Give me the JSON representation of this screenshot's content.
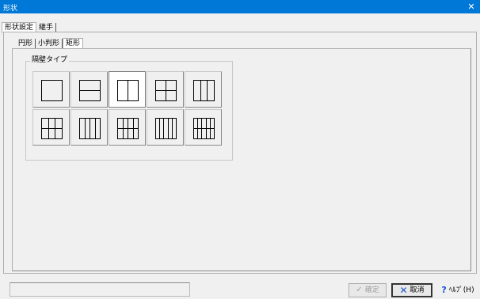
{
  "window": {
    "title": "形状"
  },
  "outer_tabs": [
    {
      "label": "形状設定",
      "active": true
    },
    {
      "label": "継手",
      "active": false
    }
  ],
  "inner_tabs": [
    {
      "label": "円形",
      "active": false
    },
    {
      "label": "小判形",
      "active": false
    },
    {
      "label": "矩形",
      "active": true
    }
  ],
  "partition": {
    "group_label": "隔壁タイプ",
    "selected": "1x2",
    "options": [
      {
        "name": "1x1",
        "rows": 1,
        "cols": 1
      },
      {
        "name": "2x1",
        "rows": 2,
        "cols": 1
      },
      {
        "name": "1x2",
        "rows": 1,
        "cols": 2
      },
      {
        "name": "2x2",
        "rows": 2,
        "cols": 2
      },
      {
        "name": "1x3",
        "rows": 1,
        "cols": 3
      },
      {
        "name": "2x3",
        "rows": 2,
        "cols": 3
      },
      {
        "name": "1x4",
        "rows": 1,
        "cols": 4
      },
      {
        "name": "2x4",
        "rows": 2,
        "cols": 4
      },
      {
        "name": "1x5",
        "rows": 1,
        "cols": 5
      },
      {
        "name": "2x5",
        "rows": 2,
        "cols": 5
      }
    ]
  },
  "buttons": {
    "ok": "確定",
    "cancel": "取消",
    "help": "ﾍﾙﾌﾟ(H)"
  },
  "icons": {
    "ok": "checkmark-pencil-icon",
    "cancel": "x-icon",
    "help": "question-mark-icon",
    "close": "close-icon"
  },
  "status": {
    "text": ""
  }
}
